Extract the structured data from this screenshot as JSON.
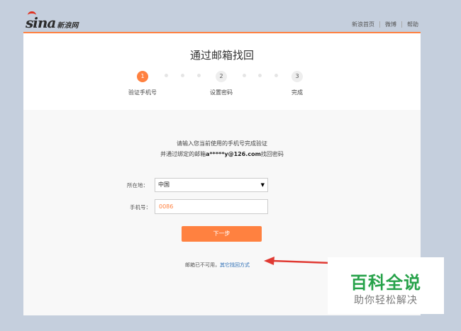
{
  "brand": {
    "logo_main": "sina",
    "logo_sub": "新浪网"
  },
  "top_links": [
    "新浪首页",
    "微博",
    "帮助"
  ],
  "page_title": "通过邮箱找回",
  "steps": [
    {
      "num": "1",
      "label": "验证手机号",
      "state": "active"
    },
    {
      "num": "2",
      "label": "设置密码",
      "state": "todo"
    },
    {
      "num": "3",
      "label": "完成",
      "state": "todo"
    }
  ],
  "intro": {
    "line1": "请输入您当前使用的手机号完成验证",
    "line2_prefix": "并通过绑定的邮箱",
    "line2_email": "a*****y@126.com",
    "line2_suffix": "找回密码"
  },
  "form": {
    "region_label": "所在地：",
    "region_value": "中国",
    "phone_label": "手机号：",
    "phone_value": "0086"
  },
  "next_button": "下一步",
  "alt": {
    "text": "邮箱已不可用，",
    "link": "其它找回方式"
  },
  "watermark": {
    "main": "百科全说",
    "sub": "助你轻松解决"
  },
  "colors": {
    "accent": "#ff8140",
    "link": "#2a6db5",
    "arrow": "#e03a33",
    "watermark": "#27a24a"
  }
}
